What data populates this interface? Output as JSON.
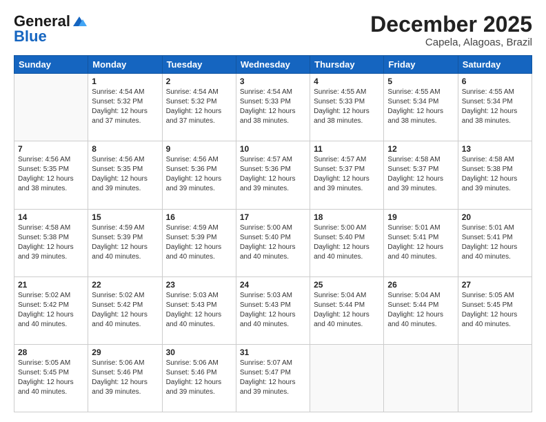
{
  "header": {
    "logo_line1": "General",
    "logo_line2": "Blue",
    "month": "December 2025",
    "location": "Capela, Alagoas, Brazil"
  },
  "days_of_week": [
    "Sunday",
    "Monday",
    "Tuesday",
    "Wednesday",
    "Thursday",
    "Friday",
    "Saturday"
  ],
  "weeks": [
    [
      {
        "day": "",
        "info": ""
      },
      {
        "day": "1",
        "info": "Sunrise: 4:54 AM\nSunset: 5:32 PM\nDaylight: 12 hours\nand 37 minutes."
      },
      {
        "day": "2",
        "info": "Sunrise: 4:54 AM\nSunset: 5:32 PM\nDaylight: 12 hours\nand 37 minutes."
      },
      {
        "day": "3",
        "info": "Sunrise: 4:54 AM\nSunset: 5:33 PM\nDaylight: 12 hours\nand 38 minutes."
      },
      {
        "day": "4",
        "info": "Sunrise: 4:55 AM\nSunset: 5:33 PM\nDaylight: 12 hours\nand 38 minutes."
      },
      {
        "day": "5",
        "info": "Sunrise: 4:55 AM\nSunset: 5:34 PM\nDaylight: 12 hours\nand 38 minutes."
      },
      {
        "day": "6",
        "info": "Sunrise: 4:55 AM\nSunset: 5:34 PM\nDaylight: 12 hours\nand 38 minutes."
      }
    ],
    [
      {
        "day": "7",
        "info": "Sunrise: 4:56 AM\nSunset: 5:35 PM\nDaylight: 12 hours\nand 38 minutes."
      },
      {
        "day": "8",
        "info": "Sunrise: 4:56 AM\nSunset: 5:35 PM\nDaylight: 12 hours\nand 39 minutes."
      },
      {
        "day": "9",
        "info": "Sunrise: 4:56 AM\nSunset: 5:36 PM\nDaylight: 12 hours\nand 39 minutes."
      },
      {
        "day": "10",
        "info": "Sunrise: 4:57 AM\nSunset: 5:36 PM\nDaylight: 12 hours\nand 39 minutes."
      },
      {
        "day": "11",
        "info": "Sunrise: 4:57 AM\nSunset: 5:37 PM\nDaylight: 12 hours\nand 39 minutes."
      },
      {
        "day": "12",
        "info": "Sunrise: 4:58 AM\nSunset: 5:37 PM\nDaylight: 12 hours\nand 39 minutes."
      },
      {
        "day": "13",
        "info": "Sunrise: 4:58 AM\nSunset: 5:38 PM\nDaylight: 12 hours\nand 39 minutes."
      }
    ],
    [
      {
        "day": "14",
        "info": "Sunrise: 4:58 AM\nSunset: 5:38 PM\nDaylight: 12 hours\nand 39 minutes."
      },
      {
        "day": "15",
        "info": "Sunrise: 4:59 AM\nSunset: 5:39 PM\nDaylight: 12 hours\nand 40 minutes."
      },
      {
        "day": "16",
        "info": "Sunrise: 4:59 AM\nSunset: 5:39 PM\nDaylight: 12 hours\nand 40 minutes."
      },
      {
        "day": "17",
        "info": "Sunrise: 5:00 AM\nSunset: 5:40 PM\nDaylight: 12 hours\nand 40 minutes."
      },
      {
        "day": "18",
        "info": "Sunrise: 5:00 AM\nSunset: 5:40 PM\nDaylight: 12 hours\nand 40 minutes."
      },
      {
        "day": "19",
        "info": "Sunrise: 5:01 AM\nSunset: 5:41 PM\nDaylight: 12 hours\nand 40 minutes."
      },
      {
        "day": "20",
        "info": "Sunrise: 5:01 AM\nSunset: 5:41 PM\nDaylight: 12 hours\nand 40 minutes."
      }
    ],
    [
      {
        "day": "21",
        "info": "Sunrise: 5:02 AM\nSunset: 5:42 PM\nDaylight: 12 hours\nand 40 minutes."
      },
      {
        "day": "22",
        "info": "Sunrise: 5:02 AM\nSunset: 5:42 PM\nDaylight: 12 hours\nand 40 minutes."
      },
      {
        "day": "23",
        "info": "Sunrise: 5:03 AM\nSunset: 5:43 PM\nDaylight: 12 hours\nand 40 minutes."
      },
      {
        "day": "24",
        "info": "Sunrise: 5:03 AM\nSunset: 5:43 PM\nDaylight: 12 hours\nand 40 minutes."
      },
      {
        "day": "25",
        "info": "Sunrise: 5:04 AM\nSunset: 5:44 PM\nDaylight: 12 hours\nand 40 minutes."
      },
      {
        "day": "26",
        "info": "Sunrise: 5:04 AM\nSunset: 5:44 PM\nDaylight: 12 hours\nand 40 minutes."
      },
      {
        "day": "27",
        "info": "Sunrise: 5:05 AM\nSunset: 5:45 PM\nDaylight: 12 hours\nand 40 minutes."
      }
    ],
    [
      {
        "day": "28",
        "info": "Sunrise: 5:05 AM\nSunset: 5:45 PM\nDaylight: 12 hours\nand 40 minutes."
      },
      {
        "day": "29",
        "info": "Sunrise: 5:06 AM\nSunset: 5:46 PM\nDaylight: 12 hours\nand 39 minutes."
      },
      {
        "day": "30",
        "info": "Sunrise: 5:06 AM\nSunset: 5:46 PM\nDaylight: 12 hours\nand 39 minutes."
      },
      {
        "day": "31",
        "info": "Sunrise: 5:07 AM\nSunset: 5:47 PM\nDaylight: 12 hours\nand 39 minutes."
      },
      {
        "day": "",
        "info": ""
      },
      {
        "day": "",
        "info": ""
      },
      {
        "day": "",
        "info": ""
      }
    ]
  ]
}
